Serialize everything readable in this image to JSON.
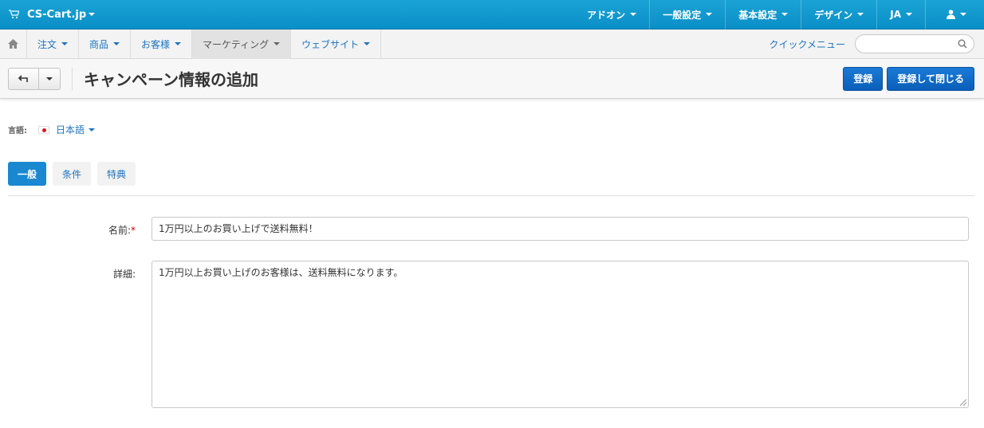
{
  "topbar": {
    "brand": "CS-Cart.jp",
    "menu": [
      "アドオン",
      "一般設定",
      "基本設定",
      "デザイン",
      "JA"
    ]
  },
  "nav": {
    "items": [
      "注文",
      "商品",
      "お客様",
      "マーケティング",
      "ウェブサイト"
    ],
    "active": "マーケティング",
    "quick_menu": "クイックメニュー",
    "search_placeholder": ""
  },
  "title": {
    "text": "キャンペーン情報の追加",
    "save_label": "登録",
    "save_close_label": "登録して閉じる"
  },
  "language": {
    "label": "言語:",
    "value": "日本語"
  },
  "tabs": {
    "items": [
      "一般",
      "条件",
      "特典"
    ],
    "active": "一般"
  },
  "form": {
    "name_label": "名前:",
    "name_required": "*",
    "name_value": "1万円以上のお買い上げで送料無料！",
    "detail_label": "詳細:",
    "detail_value": "1万円以上お買い上げのお客様は、送料無料になります。"
  },
  "colors": {
    "topbar": "#0a8fc6",
    "primary_button": "#0a5fb8",
    "active_tab": "#1a88d0",
    "link": "#1e73be"
  }
}
